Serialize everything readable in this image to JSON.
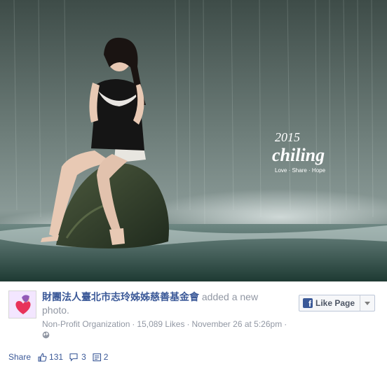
{
  "photo": {
    "watermark": {
      "year": "2015",
      "script_name": "chiling",
      "tagline": "Love · Share · Hope"
    }
  },
  "post": {
    "page_name": "財團法人臺北市志玲姊姊慈善基金會",
    "action_text": "added a new photo.",
    "category": "Non-Profit Organization",
    "likes_count": "15,089 Likes",
    "date": "November 26 at 5:26pm",
    "separator": "·",
    "privacy_icon": "globe-icon"
  },
  "like_page_button": {
    "label": "Like Page",
    "icon": "facebook-f-icon",
    "dropdown_icon": "caret-down-icon"
  },
  "actions": {
    "share_label": "Share",
    "likes": "131",
    "shares": "3",
    "comments": "2"
  },
  "colors": {
    "link": "#3b5998",
    "muted": "#9197a3",
    "text": "#141823"
  }
}
